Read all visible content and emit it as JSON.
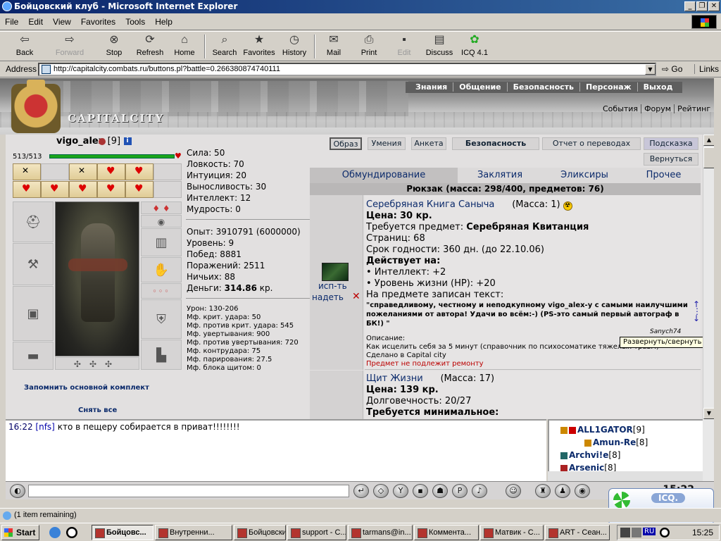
{
  "window": {
    "title": "Бойцовский клуб - Microsoft Internet Explorer",
    "min": "_",
    "max": "❐",
    "close": "✕"
  },
  "menu": [
    "File",
    "Edit",
    "View",
    "Favorites",
    "Tools",
    "Help"
  ],
  "toolbar": [
    {
      "label": "Back",
      "icon": "back-arrow-icon",
      "glyph": "⇦"
    },
    {
      "label": "Forward",
      "icon": "forward-arrow-icon",
      "glyph": "⇨",
      "disabled": true
    },
    {
      "label": "Stop",
      "icon": "stop-icon",
      "glyph": "⊗"
    },
    {
      "label": "Refresh",
      "icon": "refresh-icon",
      "glyph": "⟳"
    },
    {
      "label": "Home",
      "icon": "home-icon",
      "glyph": "⌂"
    },
    {
      "label": "Search",
      "icon": "search-icon",
      "glyph": "⌕"
    },
    {
      "label": "Favorites",
      "icon": "favorites-icon",
      "glyph": "★"
    },
    {
      "label": "History",
      "icon": "history-icon",
      "glyph": "◷"
    },
    {
      "label": "Mail",
      "icon": "mail-icon",
      "glyph": "✉"
    },
    {
      "label": "Print",
      "icon": "print-icon",
      "glyph": "⎙"
    },
    {
      "label": "Edit",
      "icon": "edit-icon",
      "glyph": "▪",
      "disabled": true
    },
    {
      "label": "Discuss",
      "icon": "discuss-icon",
      "glyph": "▤"
    },
    {
      "label": "ICQ 4.1",
      "icon": "icq-icon",
      "glyph": "✿"
    }
  ],
  "address": {
    "label": "Address",
    "url": "http://capitalcity.combats.ru/buttons.pl?battle=0.266380874740111",
    "go": "Go",
    "links": "Links"
  },
  "site": {
    "logo_text": "CAPITALCITY",
    "topnav": [
      "Знания",
      "Общение",
      "Безопасность",
      "Персонаж",
      "Выход"
    ],
    "subnav": [
      "События",
      "Форум",
      "Рейтинг"
    ]
  },
  "character": {
    "name": "vigo_alex",
    "level": "[9]",
    "info": "i",
    "hp_text": "513/513",
    "hp_fraction": 1.0,
    "stats": [
      "Сила: 50",
      "Ловкость: 70",
      "Интуиция: 20",
      "Выносливость: 30",
      "Интеллект: 12",
      "Мудрость: 0"
    ],
    "exp": [
      "Опыт: 3910791 (6000000)",
      "Уровень: 9",
      "Побед: 8881",
      "Поражений: 2511",
      "Ничьих: 88"
    ],
    "money_label": "Деньги:",
    "money_value": "314.86",
    "money_unit": "кр.",
    "mf": [
      "Урон: 130-206",
      "Мф. крит. удара: 50",
      "Мф. против крит. удара: 545",
      "Мф. увертывания: 900",
      "Мф. против увертывания: 720",
      "Мф. контрудара: 75",
      "Мф. парирования: 27.5",
      "Мф. блока щитом: 0"
    ],
    "remember_set": "Запомнить основной комплект",
    "take_off_all": "Снять все"
  },
  "panel_buttons": {
    "image": "Образ",
    "skills": "Умения",
    "form": "Анкета",
    "security": "Безопасность",
    "transfers": "Отчет о переводах",
    "hint": "Подсказка",
    "back": "Вернуться"
  },
  "tabs": [
    "Обмундирование",
    "Заклятия",
    "Эликсиры",
    "Прочее"
  ],
  "backpack": "Рюкзак (масса: 298/400, предметов: 76)",
  "item1": {
    "name": "Серебряная Книга Саныча",
    "mass": "(Масса: 1)",
    "price_label": "Цена:",
    "price": "30 кр.",
    "req_label": "Требуется предмет:",
    "req_value": "Серебряная Квитанция",
    "pages": "Страниц: 68",
    "expiry": "Срок годности: 360 дн. (до 22.10.06)",
    "acts_label": "Действует на:",
    "acts": [
      "• Интеллект: +2",
      "• Уровень жизни (HP): +20"
    ],
    "inscription_label": "На предмете записан текст:",
    "inscription_1": "\"справедливому, честному и неподкупному vigo_alex-у с самыми наилучшими",
    "inscription_2": "пожеланиями от автора! Удачи во всём:-) (PS-это самый первый автограф в",
    "inscription_3": "БК!) \"",
    "signature": "Sanych74",
    "desc_label": "Описание:",
    "desc_1": "Как исцелить себя за 5 минут (справочник по психосоматике тяжелых травм)",
    "desc_2": "Сделано в Capital city",
    "repair": "Предмет не подлежит ремонту",
    "use": "исп-ть",
    "wear": "надеть"
  },
  "item2": {
    "name": "Щит Жизни",
    "mass": "(Масса: 17)",
    "price_label": "Цена:",
    "price": "139 кр.",
    "durability": "Долговечность: 20/27",
    "req": "Требуется минимальное:"
  },
  "tooltip": "Развернуть/свернуть лист",
  "chat": {
    "time": "16:22",
    "nick": "[nfs]",
    "text": "кто в пещеру собирается в приват!!!!!!!!"
  },
  "users": [
    {
      "name": "ALL1GATOR",
      "level": "[9]"
    },
    {
      "name": "Amun-Re",
      "level": "[8]"
    },
    {
      "name": "Archvi!e",
      "level": "[8]"
    },
    {
      "name": "Arsenic",
      "level": "[8]"
    }
  ],
  "game_clock": "15:22",
  "icq": "ICQ.",
  "status": "(1 item remaining)",
  "taskbar": {
    "start": "Start",
    "tasks": [
      "Бойцовс...",
      "Внутренни...",
      "Бойцовски...",
      "support - С...",
      "tarmans@in...",
      "Коммента...",
      "Матвик - С...",
      "ART - Сеан..."
    ],
    "lang": "RU",
    "clock": "15:25"
  },
  "colors": {
    "hp_bar": "#1aa51a",
    "link": "#0b2a6b",
    "title_bar": "#0a246a"
  }
}
